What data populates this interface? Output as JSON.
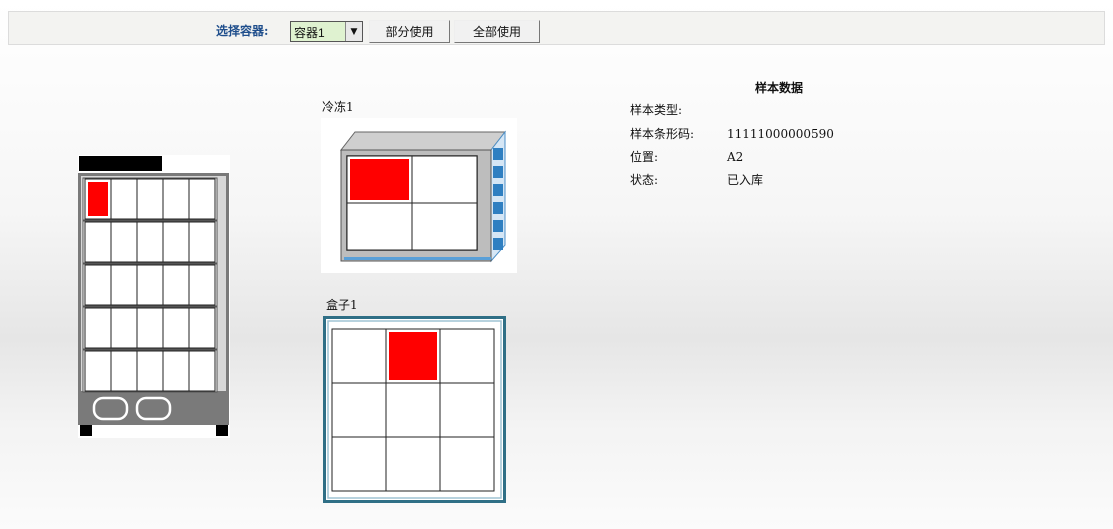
{
  "toolbar": {
    "select_label": "选择容器:",
    "selected_container": "容器1",
    "partial_use_label": "部分使用",
    "full_use_label": "全部使用"
  },
  "freezer": {
    "label": "冷冻1",
    "rows": 2,
    "cols": 2,
    "highlight": {
      "row": 0,
      "col": 0,
      "color": "#ff0000"
    }
  },
  "rack": {
    "rows": 5,
    "cols": 5,
    "highlight": {
      "row": 0,
      "col": 0,
      "color": "#ff0000"
    }
  },
  "box": {
    "label": "盒子1",
    "rows": 3,
    "cols": 3,
    "highlight": {
      "row": 0,
      "col": 1,
      "color": "#ff0000"
    }
  },
  "sample": {
    "title": "样本数据",
    "type_label": "样本类型:",
    "type_value": "",
    "barcode_label": "样本条形码:",
    "barcode_value": "11111000000590",
    "position_label": "位置:",
    "position_value": "A2",
    "status_label": "状态:",
    "status_value": "已入库"
  }
}
